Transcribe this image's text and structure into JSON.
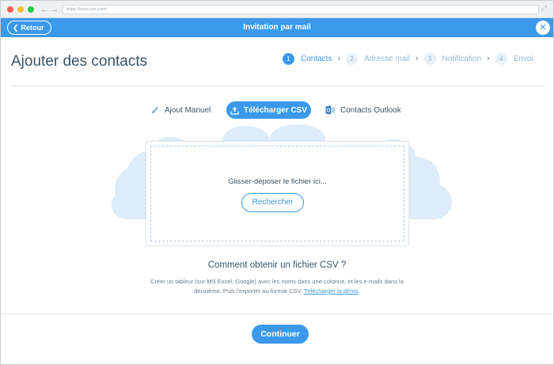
{
  "browser": {
    "address": "https://www.wix.com/",
    "icons": {
      "back": "arrow-left-icon",
      "forward": "arrow-right-icon",
      "expand": "expand-icon"
    }
  },
  "header": {
    "back_label": "Retour",
    "title": "Invitation par mail",
    "close_symbol": "✕",
    "accent_color": "#3a99ea"
  },
  "page": {
    "title": "Ajouter des contacts"
  },
  "steps": [
    {
      "number": "1",
      "label": "Contacts",
      "active": true
    },
    {
      "number": "2",
      "label": "Adresse mail",
      "active": false
    },
    {
      "number": "3",
      "label": "Notification",
      "active": false
    },
    {
      "number": "4",
      "label": "Envoi",
      "active": false
    }
  ],
  "tabs": {
    "manual": {
      "label": "Ajout Manuel",
      "icon": "pencil-icon"
    },
    "csv": {
      "label": "Télécharger CSV",
      "icon": "upload-icon",
      "selected": true
    },
    "outlook": {
      "label": "Contacts Outlook",
      "icon": "outlook-icon"
    }
  },
  "dropzone": {
    "text": "Glisser-déposer le fichier ici...",
    "browse_label": "Rechercher"
  },
  "help": {
    "title": "Comment obtenir un fichier CSV ?",
    "text": "Créer un tableur (sur MS Excel, Google) avec les noms dans une colonne, et les e-mails dans la deuxième. Puis l'exporter au format CSV.",
    "link": "Télécharger la démo",
    "end": "."
  },
  "footer": {
    "continue_label": "Continuer"
  }
}
